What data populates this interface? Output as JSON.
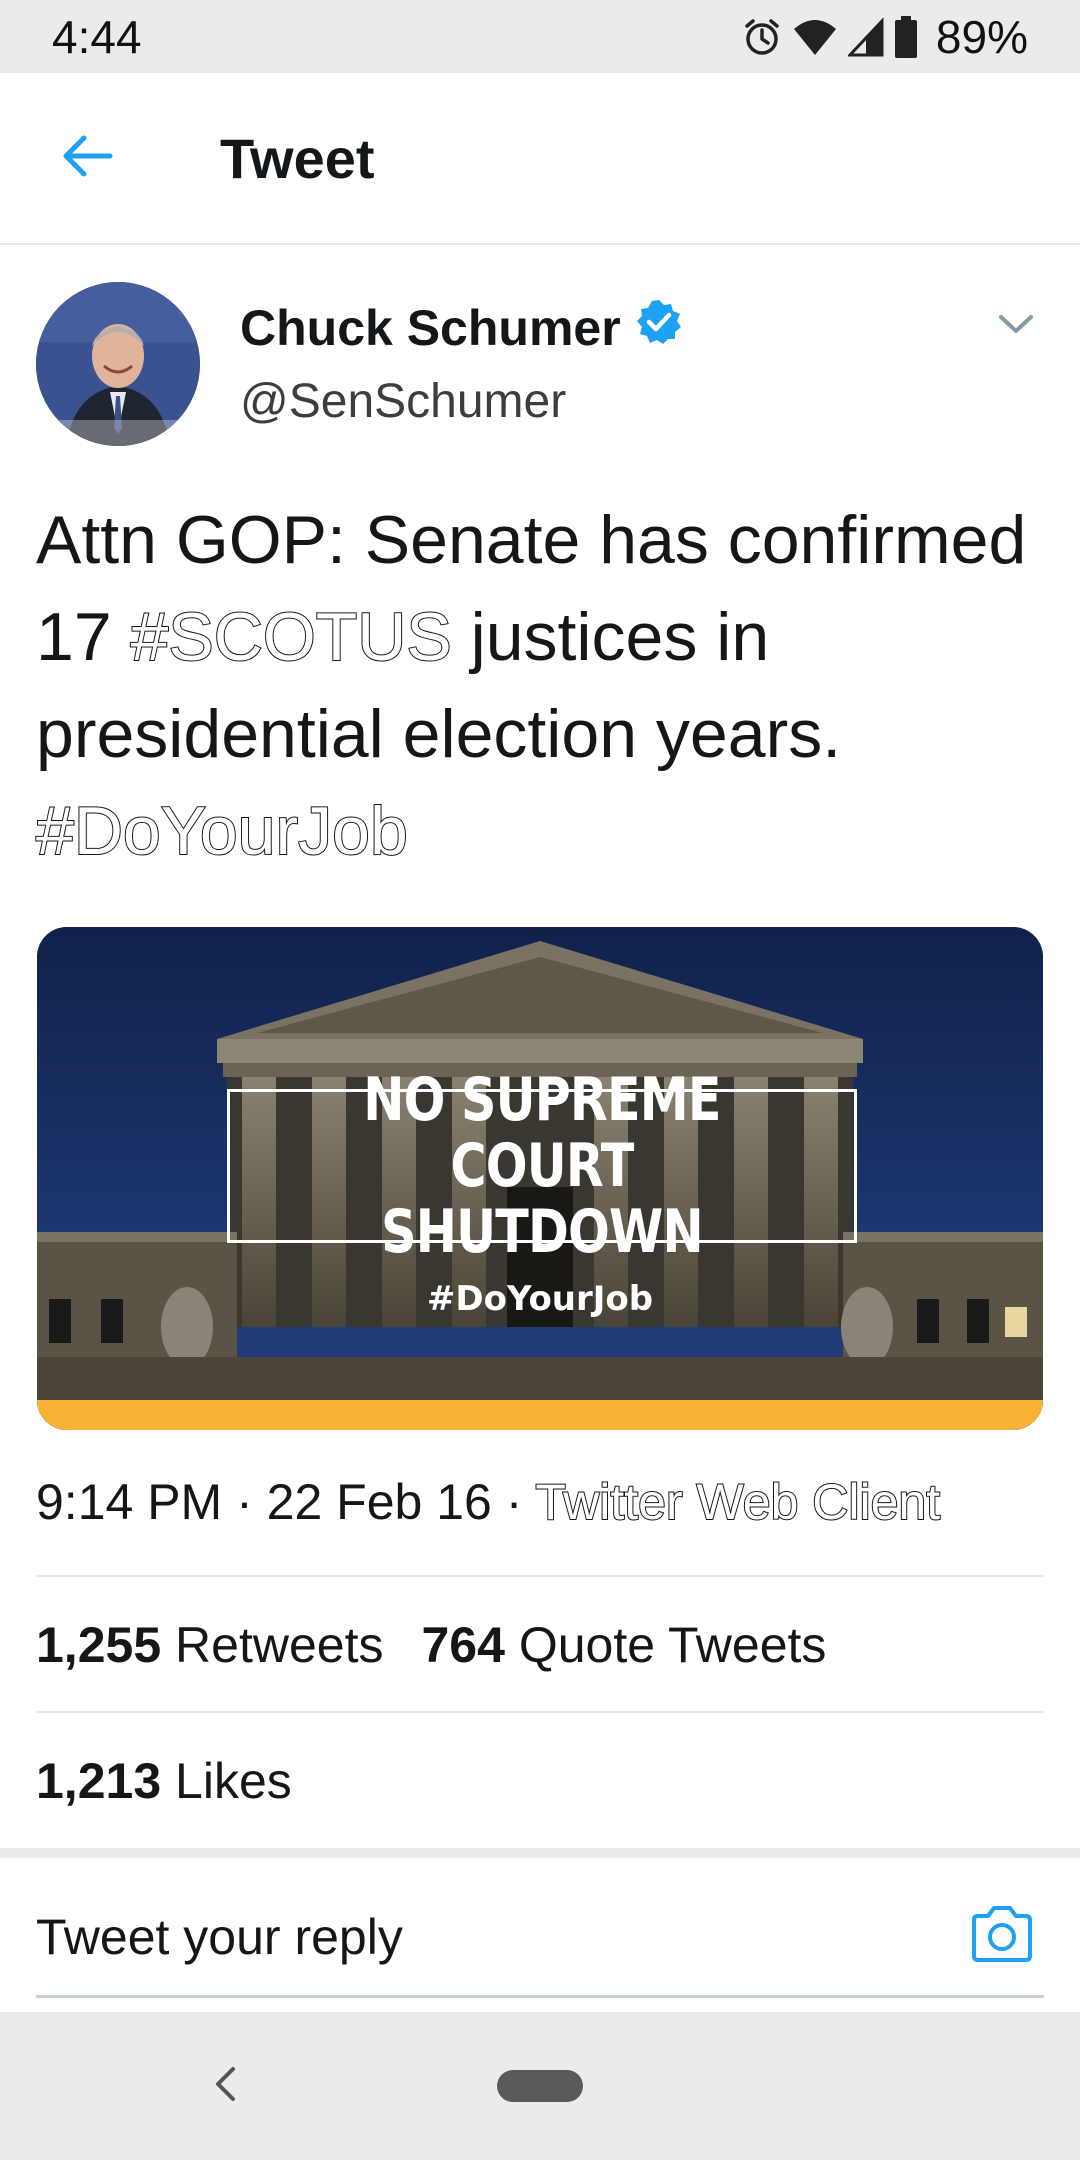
{
  "status_bar": {
    "time": "4:44",
    "battery": "89%",
    "icons": [
      "alarm-icon",
      "wifi-icon",
      "cell-signal-icon",
      "battery-icon"
    ]
  },
  "app_bar": {
    "title": "Tweet",
    "back_icon": "arrow-left-icon"
  },
  "tweet": {
    "author": {
      "name": "Chuck Schumer",
      "handle": "@SenSchumer",
      "verified": true
    },
    "text": {
      "part1": "Attn GOP: Senate has confirmed 17 ",
      "hashtag1": "#SCOTUS",
      "part2": " justices in presidential election years. ",
      "hashtag2": "#DoYourJob"
    },
    "media": {
      "headline": "NO SUPREME COURT\nSHUTDOWN",
      "hashtag": "#DoYourJob"
    },
    "meta": {
      "time": "9:14 PM",
      "date": "22 Feb 16",
      "source": "Twitter Web Client"
    },
    "stats": {
      "retweets_count": "1,255",
      "retweets_label": "Retweets",
      "quotes_count": "764",
      "quotes_label": "Quote Tweets",
      "likes_count": "1,213",
      "likes_label": "Likes"
    }
  },
  "reply": {
    "placeholder": "Tweet your reply"
  },
  "colors": {
    "accent": "#1da1f2",
    "text": "#14171a",
    "divider": "#e1e8ed",
    "banner_stripe": "#f9b234"
  }
}
